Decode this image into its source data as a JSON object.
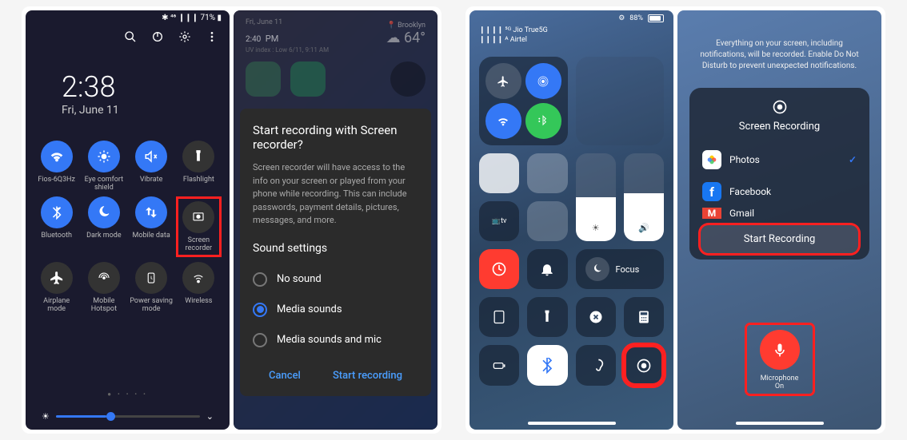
{
  "android_left": {
    "status": "✱ ⁴⁶ ❙❙❙ 71% ▮",
    "time": "2:38",
    "date": "Fri, June 11",
    "tiles": [
      {
        "label": "Fios-6Q3Hz",
        "icon": "wifi",
        "on": true
      },
      {
        "label": "Eye comfort shield",
        "icon": "sun",
        "on": true
      },
      {
        "label": "Vibrate",
        "icon": "speaker-mute",
        "on": true
      },
      {
        "label": "Flashlight",
        "icon": "flashlight",
        "on": false
      },
      {
        "label": "Bluetooth",
        "icon": "bluetooth",
        "on": true
      },
      {
        "label": "Dark mode",
        "icon": "moon",
        "on": true
      },
      {
        "label": "Mobile data",
        "icon": "swap",
        "on": true
      },
      {
        "label": "Screen recorder",
        "icon": "screen-rec",
        "on": false,
        "highlight": true
      },
      {
        "label": "Airplane mode",
        "icon": "airplane",
        "on": false
      },
      {
        "label": "Mobile Hotspot",
        "icon": "hotspot",
        "on": false
      },
      {
        "label": "Power saving mode",
        "icon": "power-save",
        "on": false
      },
      {
        "label": "Wireless",
        "icon": "wireless",
        "on": false
      }
    ]
  },
  "android_right": {
    "date": "Fri, June 11",
    "time": "2:40",
    "ampm": "PM",
    "uvtext": "UV index : Low   6/11, 9:11 AM",
    "location": "Brooklyn",
    "temp": "64°",
    "dialog_title": "Start recording with Screen recorder?",
    "dialog_desc": "Screen recorder will have access to the info on your screen or played from your phone while recording. This can include passwords, payment details, pictures, messages, and more.",
    "sound_header": "Sound settings",
    "opt_none": "No sound",
    "opt_media": "Media sounds",
    "opt_mediamic": "Media sounds and mic",
    "cancel": "Cancel",
    "start": "Start recording"
  },
  "ios_left": {
    "carrier1": "Jio True5G",
    "carrier2": "Airtel",
    "battery": "88%",
    "tv": "tv",
    "focus": "Focus"
  },
  "ios_right": {
    "notice": "Everything on your screen, including notifications, will be recorded. Enable Do Not Disturb to prevent unexpected notifications.",
    "panel_title": "Screen Recording",
    "apps": [
      {
        "name": "Photos",
        "color": "#ffffff",
        "icon_bg": "photos",
        "checked": true
      },
      {
        "name": "Facebook",
        "color": "#1877f2",
        "checked": false
      },
      {
        "name": "Gmail",
        "color": "#ea4335",
        "checked": false,
        "partial": true
      }
    ],
    "start_btn": "Start Recording",
    "mic_label": "Microphone\nOn"
  }
}
